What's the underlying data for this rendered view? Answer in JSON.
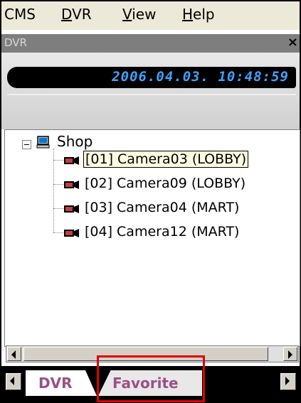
{
  "menu": {
    "items": [
      {
        "label": "CMS",
        "underline": ""
      },
      {
        "label": "DVR",
        "underline": "D"
      },
      {
        "label": "View",
        "underline": "V"
      },
      {
        "label": "Help",
        "underline": "H"
      }
    ]
  },
  "panel": {
    "title": "DVR",
    "close_label": "×"
  },
  "clock": {
    "datetime": "2006.04.03. 10:48:59"
  },
  "tree": {
    "root": {
      "label": "Shop",
      "icon": "computer-icon"
    },
    "cameras": [
      {
        "label": "[01] Camera03 (LOBBY)",
        "icon": "camera-icon",
        "selected": true
      },
      {
        "label": "[02] Camera09 (LOBBY)",
        "icon": "camera-icon",
        "selected": false
      },
      {
        "label": "[03] Camera04 (MART)",
        "icon": "camera-icon",
        "selected": false
      },
      {
        "label": "[04] Camera12 (MART)",
        "icon": "camera-icon",
        "selected": false
      }
    ]
  },
  "tabs": [
    {
      "label": "DVR",
      "active": true
    },
    {
      "label": "Favorite",
      "active": false
    }
  ],
  "colors": {
    "clock_text": "#3fa2ff",
    "tab_text": "#9c4f86",
    "highlight": "#e00000"
  }
}
